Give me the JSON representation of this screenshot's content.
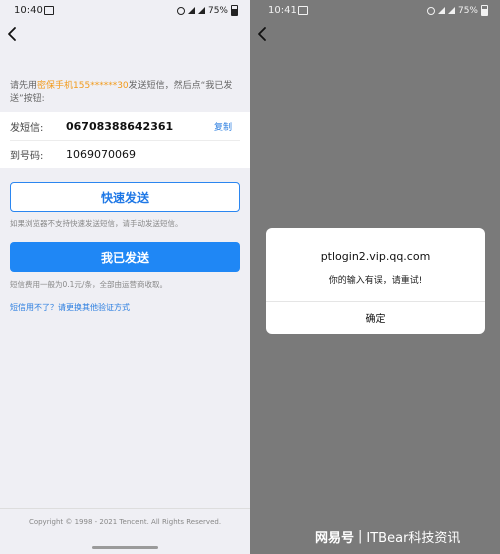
{
  "left_screen": {
    "status": {
      "time": "10:40",
      "battery": "75%"
    },
    "hint": {
      "prefix": "请先用",
      "highlight": "密保手机155******30",
      "suffix": "发送短信，然后点“我已发送”按钮:"
    },
    "sms": {
      "send_label": "发短信:",
      "send_value": "0670838864236​1",
      "copy_label": "复制",
      "to_label": "到号码:",
      "to_value": "1069070069"
    },
    "quick_send_label": "快速发送",
    "quick_send_note": "如果浏览器不支持快速发送短信，请手动发送短信。",
    "sent_label": "我已发送",
    "fee_note": "短信费用一般为0.1元/条，全部由运营商收取。",
    "alt_link": "短信用不了？请更换其他验证方式",
    "copyright": "Copyright © 1998 - 2021 Tencent. All Rights Reserved."
  },
  "right_screen": {
    "status": {
      "time": "10:41",
      "battery": "75%"
    },
    "dialog": {
      "title": "ptlogin2.vip.qq.com",
      "message": "你的输入有误，请重试!",
      "ok_label": "确定"
    }
  },
  "watermark": {
    "logo": "网易号",
    "separator": "|",
    "text": "ITBear科技资讯"
  },
  "icons": [
    "back-arrow-icon",
    "gallery-icon",
    "wifi-icon",
    "signal-icon",
    "battery-icon"
  ]
}
